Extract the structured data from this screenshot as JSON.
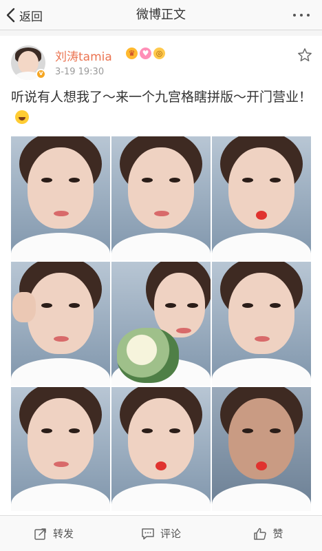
{
  "nav": {
    "back_label": "返回",
    "title": "微博正文"
  },
  "post": {
    "username": "刘涛tamia",
    "timestamp": "3-19 19:30",
    "text": "听说有人想我了～来一个九宫格瞎拼版～开门营业！",
    "photos": [
      "photo-1",
      "photo-2",
      "photo-3",
      "photo-4",
      "photo-5",
      "photo-6",
      "photo-7",
      "photo-8",
      "photo-9"
    ]
  },
  "toolbar": {
    "repost_label": "转发",
    "comment_label": "评论",
    "like_label": "赞"
  },
  "colors": {
    "username": "#eb7350",
    "verified": "#f5a623"
  },
  "icons": {
    "back": "chevron-left-icon",
    "more": "more-dots-icon",
    "favorite": "star-outline-icon",
    "repost": "repost-icon",
    "comment": "comment-icon",
    "like": "thumbs-up-icon"
  }
}
